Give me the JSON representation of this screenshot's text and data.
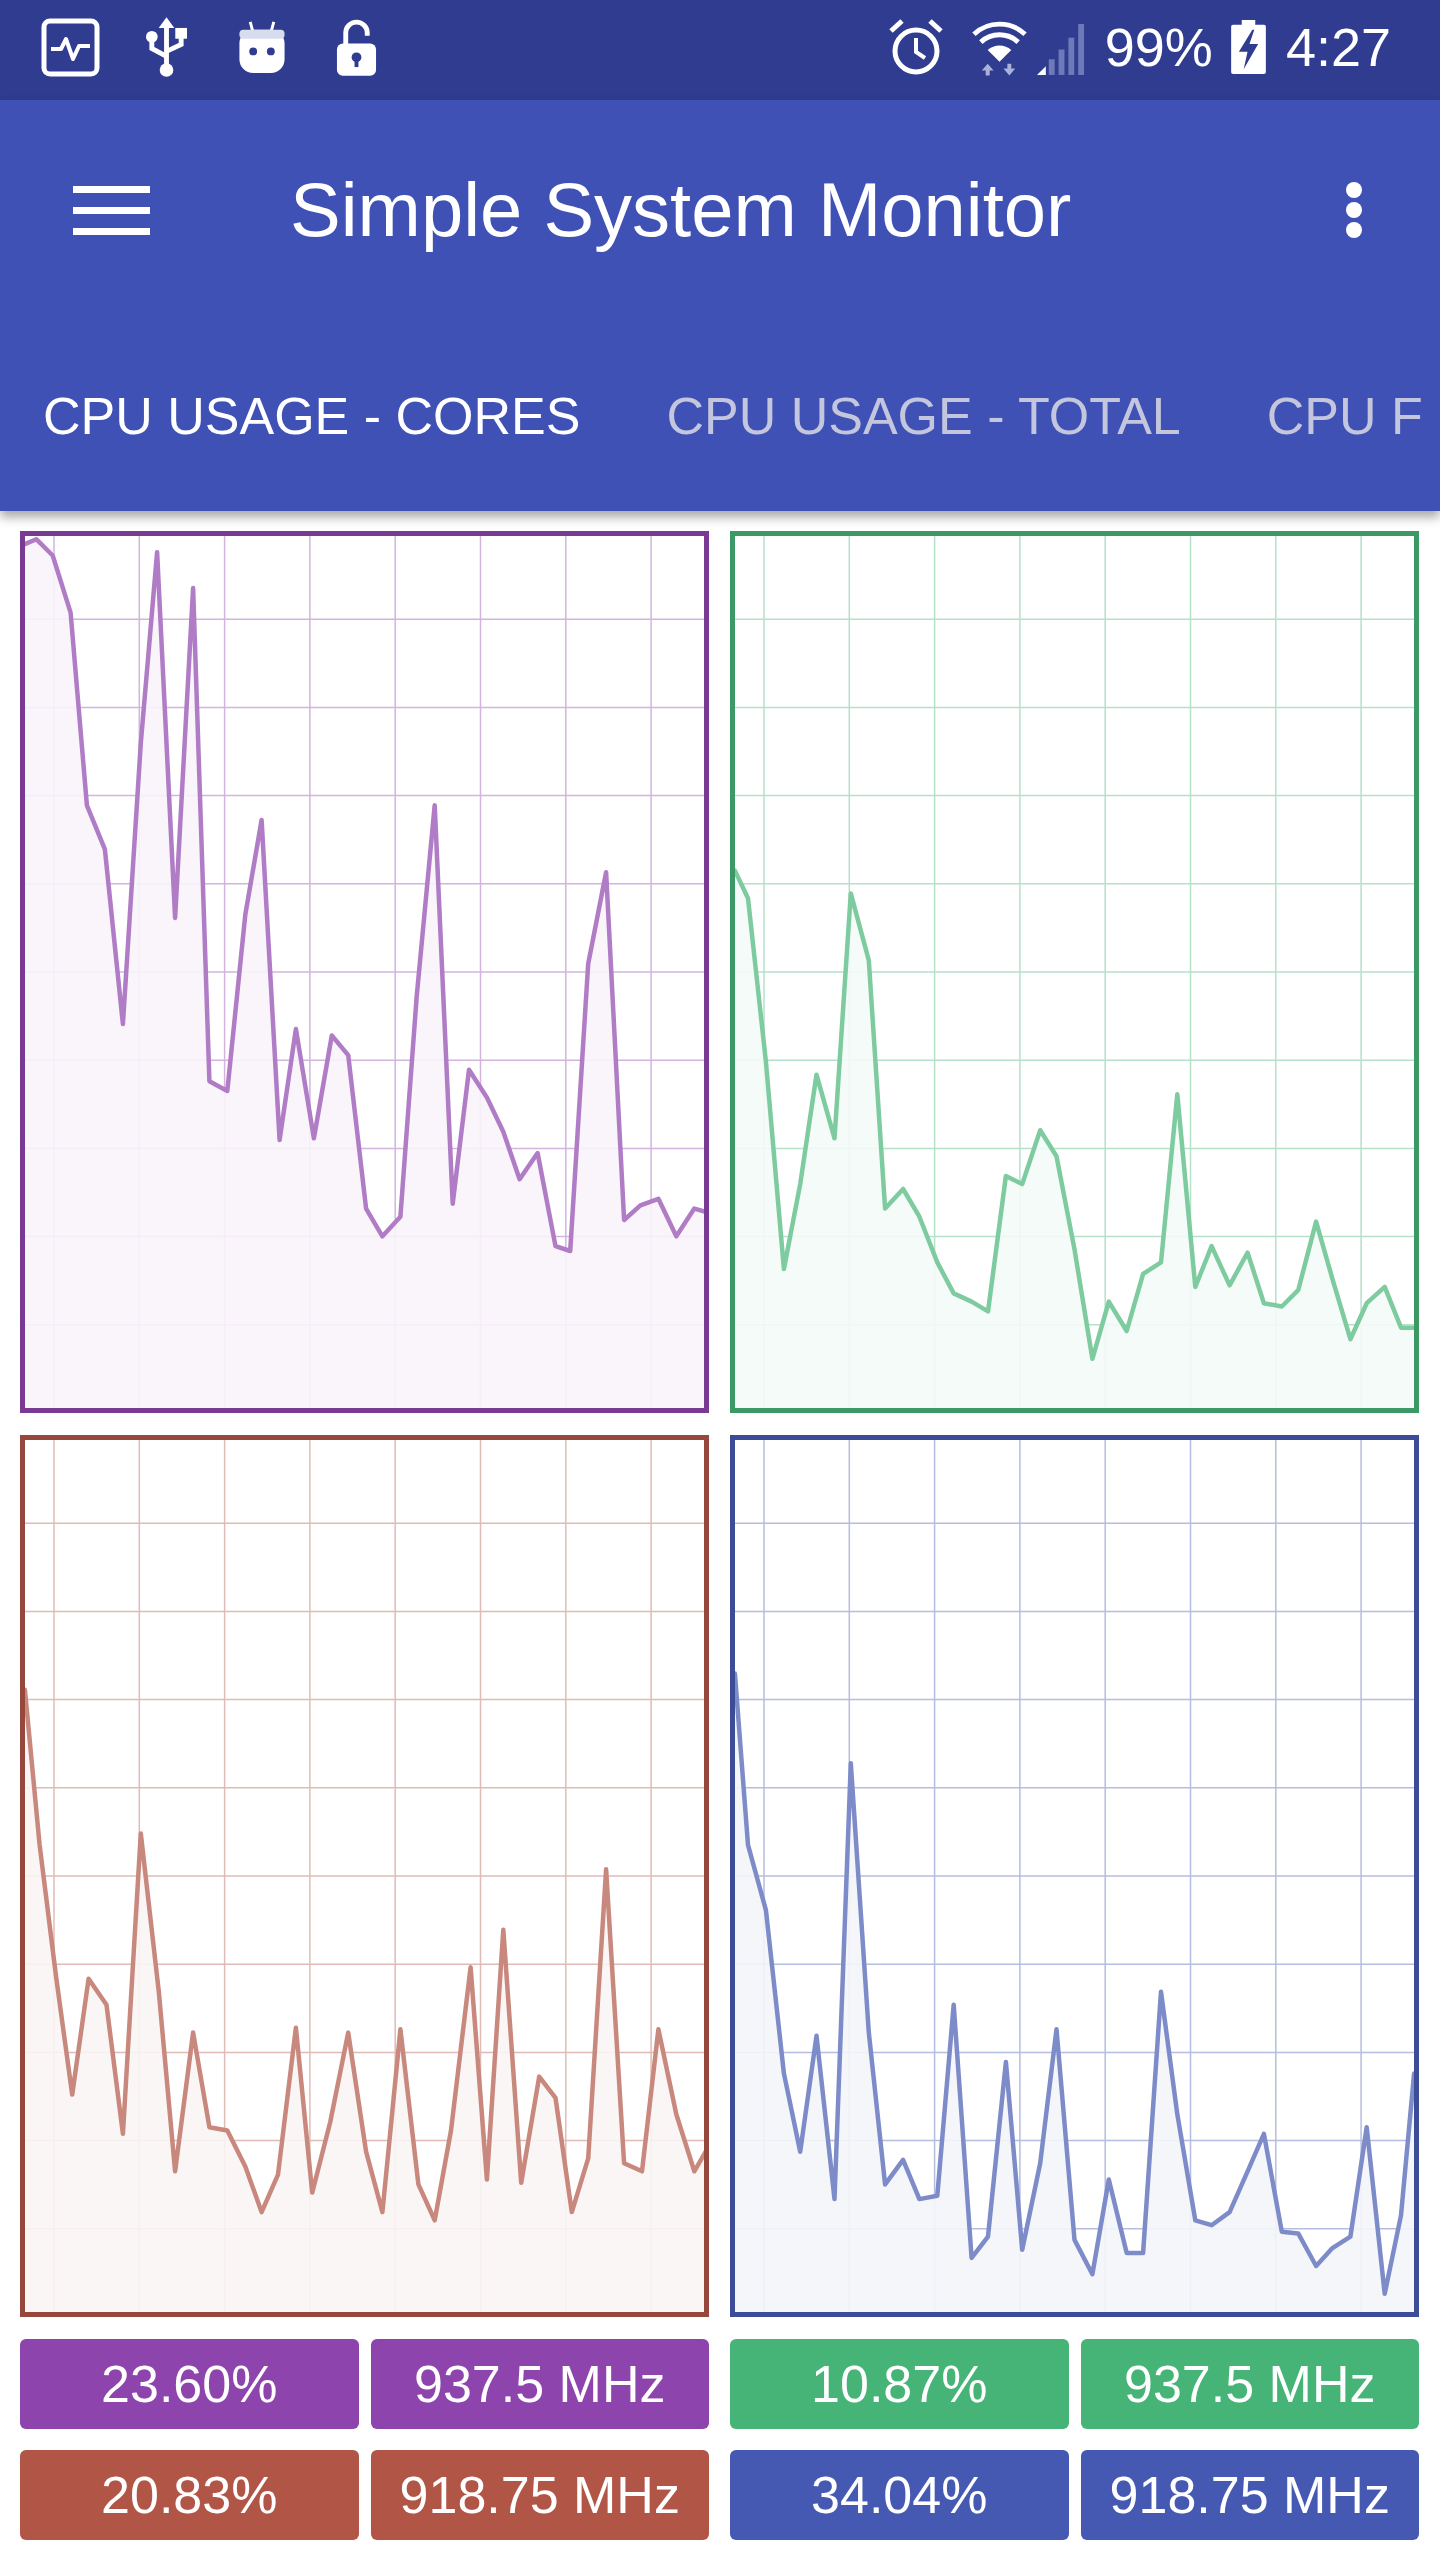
{
  "status_bar": {
    "battery": "99%",
    "time": "4:27"
  },
  "app_bar": {
    "title": "Simple System Monitor"
  },
  "tabs": [
    {
      "label": "CPU USAGE - CORES",
      "selected": true
    },
    {
      "label": "CPU USAGE - TOTAL",
      "selected": false
    },
    {
      "label": "CPU F",
      "selected": false
    }
  ],
  "cores": [
    {
      "color": "#8e44ad",
      "usage": "23.60%",
      "frequency": "937.5 MHz"
    },
    {
      "color": "#46b477",
      "usage": "10.87%",
      "frequency": "937.5 MHz"
    },
    {
      "color": "#b15546",
      "usage": "20.83%",
      "frequency": "918.75 MHz"
    },
    {
      "color": "#4659b2",
      "usage": "34.04%",
      "frequency": "918.75 MHz"
    }
  ]
}
